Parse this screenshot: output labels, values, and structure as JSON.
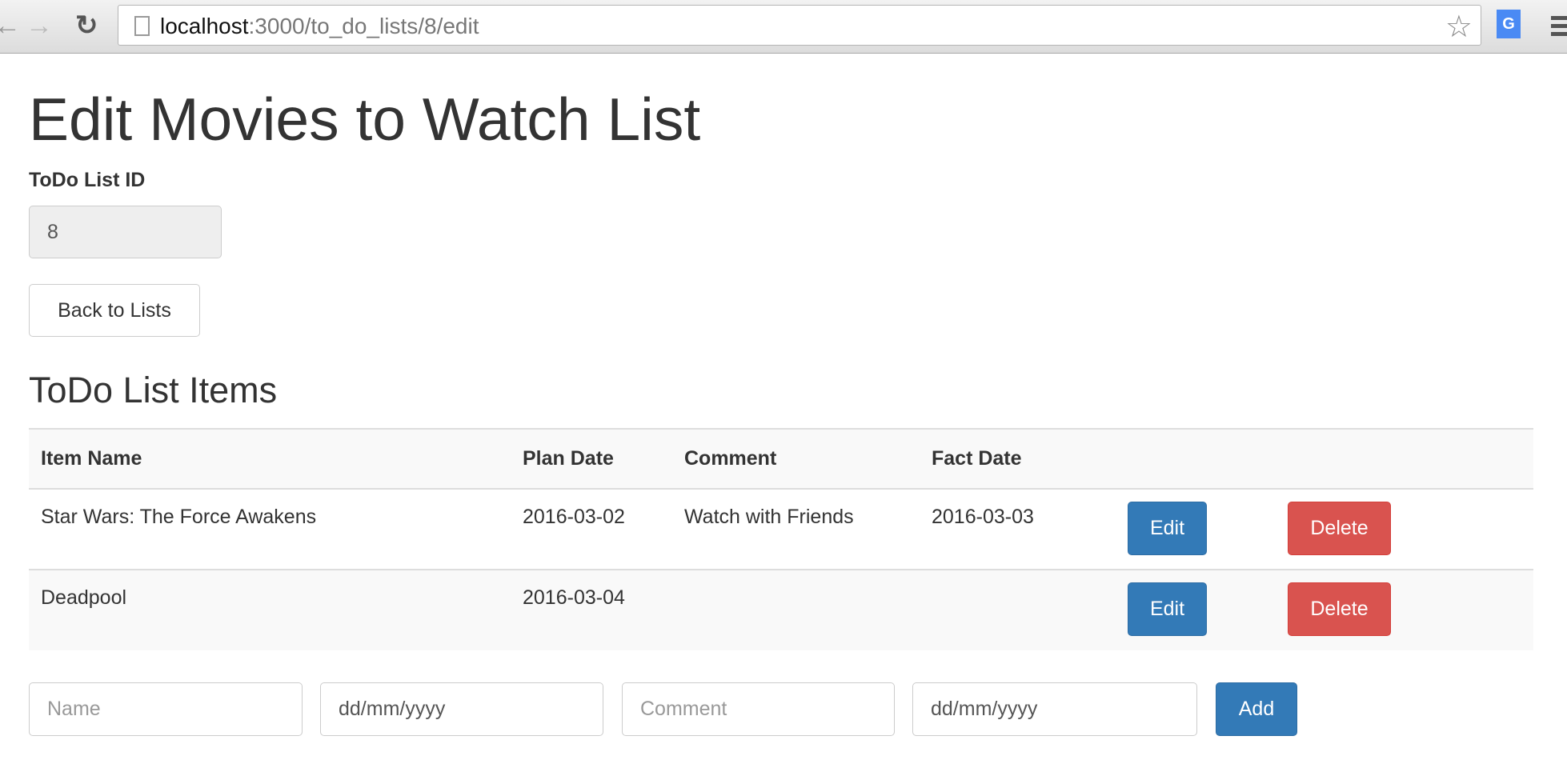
{
  "browser": {
    "url_host": "localhost",
    "url_path": ":3000/to_do_lists/8/edit",
    "back_icon": "arrow-left",
    "forward_icon": "arrow-right",
    "reload_icon": "reload",
    "star_icon": "star",
    "translate_icon": "G"
  },
  "page": {
    "title": "Edit Movies to Watch List",
    "id_label": "ToDo List ID",
    "id_value": "8",
    "back_label": "Back to Lists",
    "items_heading": "ToDo List Items"
  },
  "table": {
    "headers": [
      "Item Name",
      "Plan Date",
      "Comment",
      "Fact Date"
    ],
    "rows": [
      {
        "name": "Star Wars: The Force Awakens",
        "plan": "2016-03-02",
        "comment": "Watch with Friends",
        "fact": "2016-03-03",
        "edit": "Edit",
        "delete": "Delete"
      },
      {
        "name": "Deadpool",
        "plan": "2016-03-04",
        "comment": "",
        "fact": "",
        "edit": "Edit",
        "delete": "Delete"
      }
    ]
  },
  "form": {
    "name_placeholder": "Name",
    "plan_placeholder": "dd/mm/yyyy",
    "comment_placeholder": "Comment",
    "fact_placeholder": "dd/mm/yyyy",
    "add_label": "Add"
  },
  "colors": {
    "primary": "#337ab7",
    "danger": "#d9534f"
  }
}
